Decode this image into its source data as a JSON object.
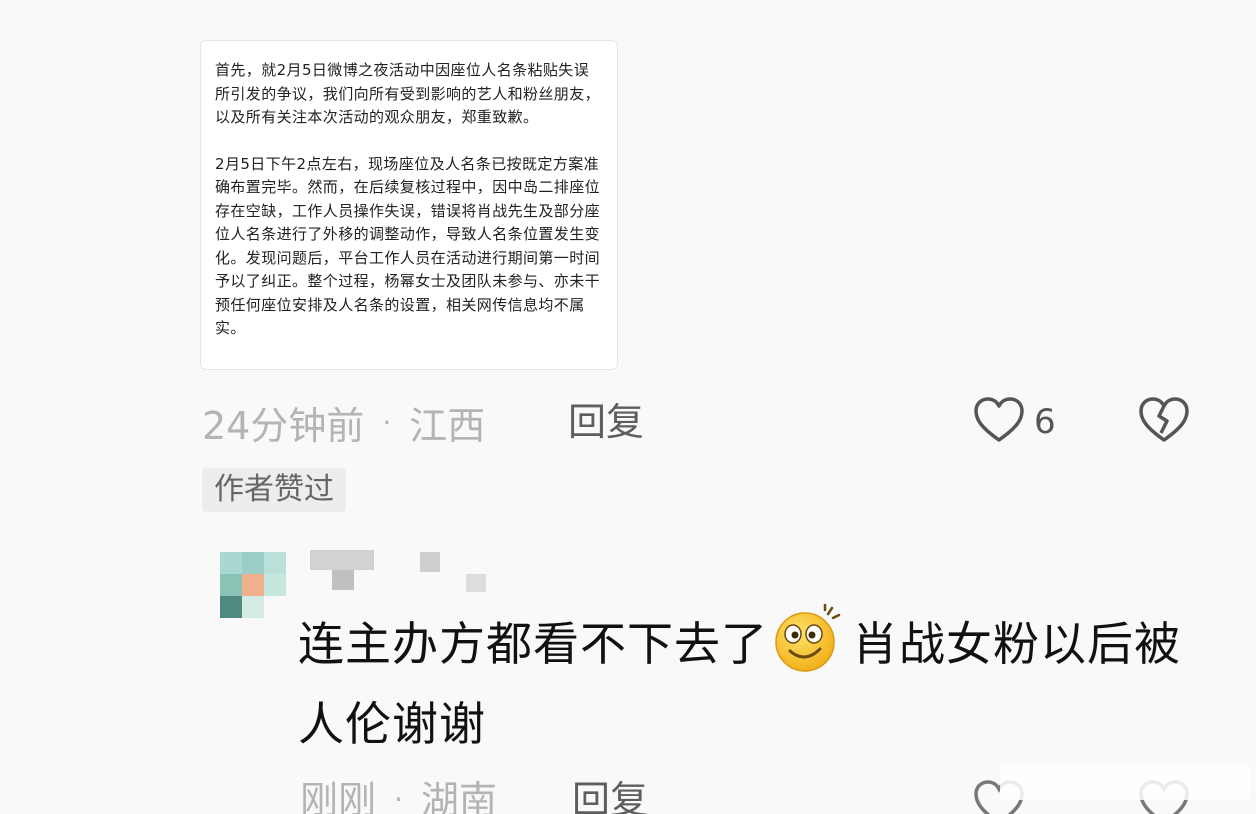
{
  "quoted_image": {
    "paragraphs": [
      "首先，就2月5日微博之夜活动中因座位人名条粘贴失误所引发的争议，我们向所有受到影响的艺人和粉丝朋友，以及所有关注本次活动的观众朋友，郑重致歉。",
      "2月5日下午2点左右，现场座位及人名条已按既定方案准确布置完毕。然而，在后续复核过程中，因中岛二排座位存在空缺，工作人员操作失误，错误将肖战先生及部分座位人名条进行了外移的调整动作，导致人名条位置发生变化。发现问题后，平台工作人员在活动进行期间第一时间予以了纠正。整个过程，杨幂女士及团队未参与、亦未干预任何座位安排及人名条的设置，相关网传信息均不属实。"
    ]
  },
  "comment1": {
    "time": "24分钟前",
    "dot": "·",
    "location": "江西",
    "reply_label": "回复",
    "like_count": "6",
    "author_liked_badge": "作者赞过"
  },
  "comment2": {
    "text_before_emoji": "连主办方都看不下去了",
    "emoji_icon": "grinning-emoji-icon",
    "text_after_emoji": "肖战女粉以后被人伦谢谢",
    "time": "刚刚",
    "dot": "·",
    "location": "湖南",
    "reply_label": "回复"
  },
  "colors": {
    "meta_gray": "#b4b4b4",
    "reply_gray": "#5e5e5e",
    "text": "#111111",
    "background": "#f9f9f9"
  }
}
